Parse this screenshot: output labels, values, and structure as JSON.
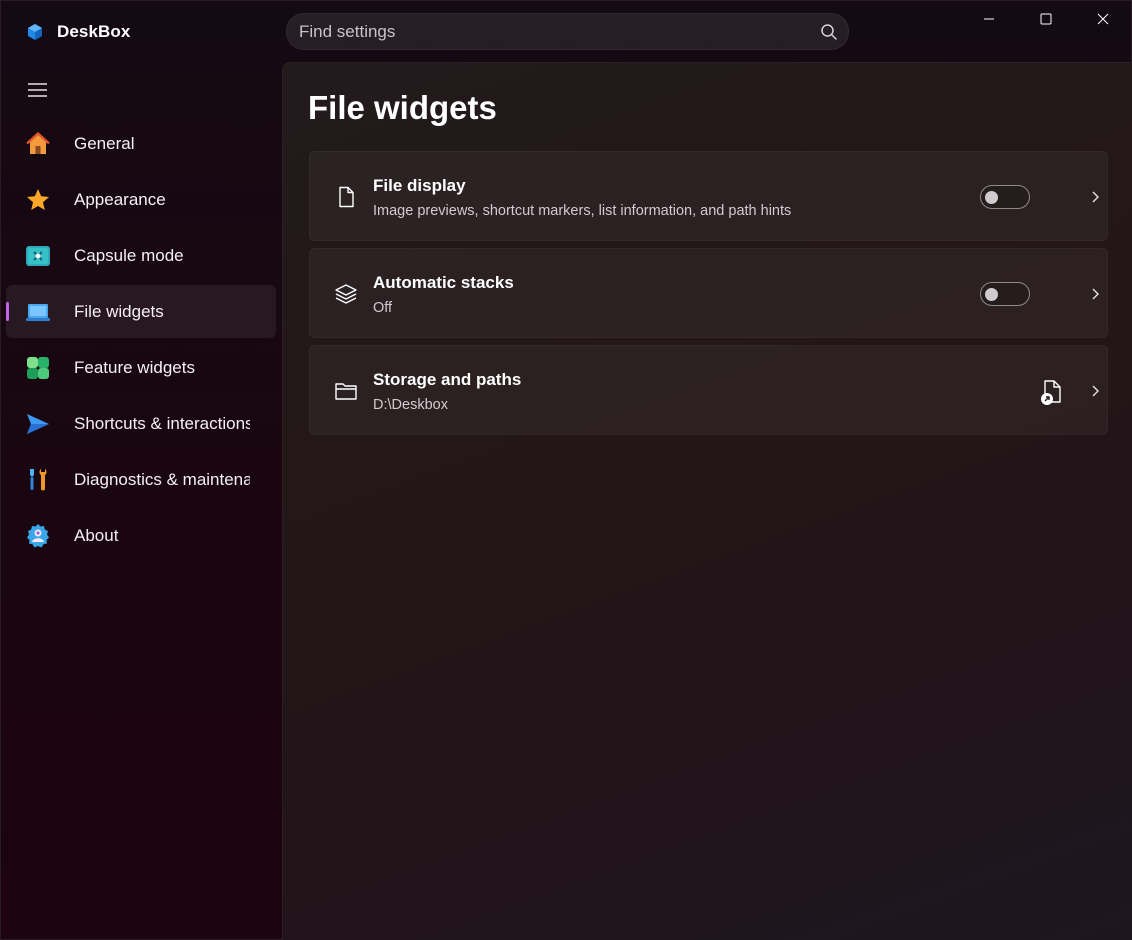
{
  "app": {
    "name": "DeskBox"
  },
  "search": {
    "placeholder": "Find settings"
  },
  "sidebar": {
    "items": [
      {
        "label": "General",
        "icon": "home-icon",
        "active": false
      },
      {
        "label": "Appearance",
        "icon": "star-icon",
        "active": false
      },
      {
        "label": "Capsule mode",
        "icon": "capsule-icon",
        "active": false
      },
      {
        "label": "File widgets",
        "icon": "laptop-icon",
        "active": true
      },
      {
        "label": "Feature widgets",
        "icon": "widgets-icon",
        "active": false
      },
      {
        "label": "Shortcuts & interactions",
        "icon": "send-icon",
        "active": false
      },
      {
        "label": "Diagnostics & maintenance",
        "icon": "tools-icon",
        "active": false
      },
      {
        "label": "About",
        "icon": "about-icon",
        "active": false
      }
    ]
  },
  "page": {
    "title": "File widgets",
    "cards": [
      {
        "title": "File display",
        "subtitle": "Image previews, shortcut markers, list information, and path hints",
        "icon": "file-icon",
        "toggle_on": false
      },
      {
        "title": "Automatic stacks",
        "subtitle": "Off",
        "icon": "layers-icon",
        "toggle_on": false
      },
      {
        "title": "Storage and paths",
        "subtitle": "D:\\Deskbox",
        "icon": "folder-icon",
        "action_icon": "open-location-icon"
      }
    ]
  },
  "colors": {
    "accent": "#c064e6",
    "background": "#1a0610",
    "card": "#2a2123"
  }
}
